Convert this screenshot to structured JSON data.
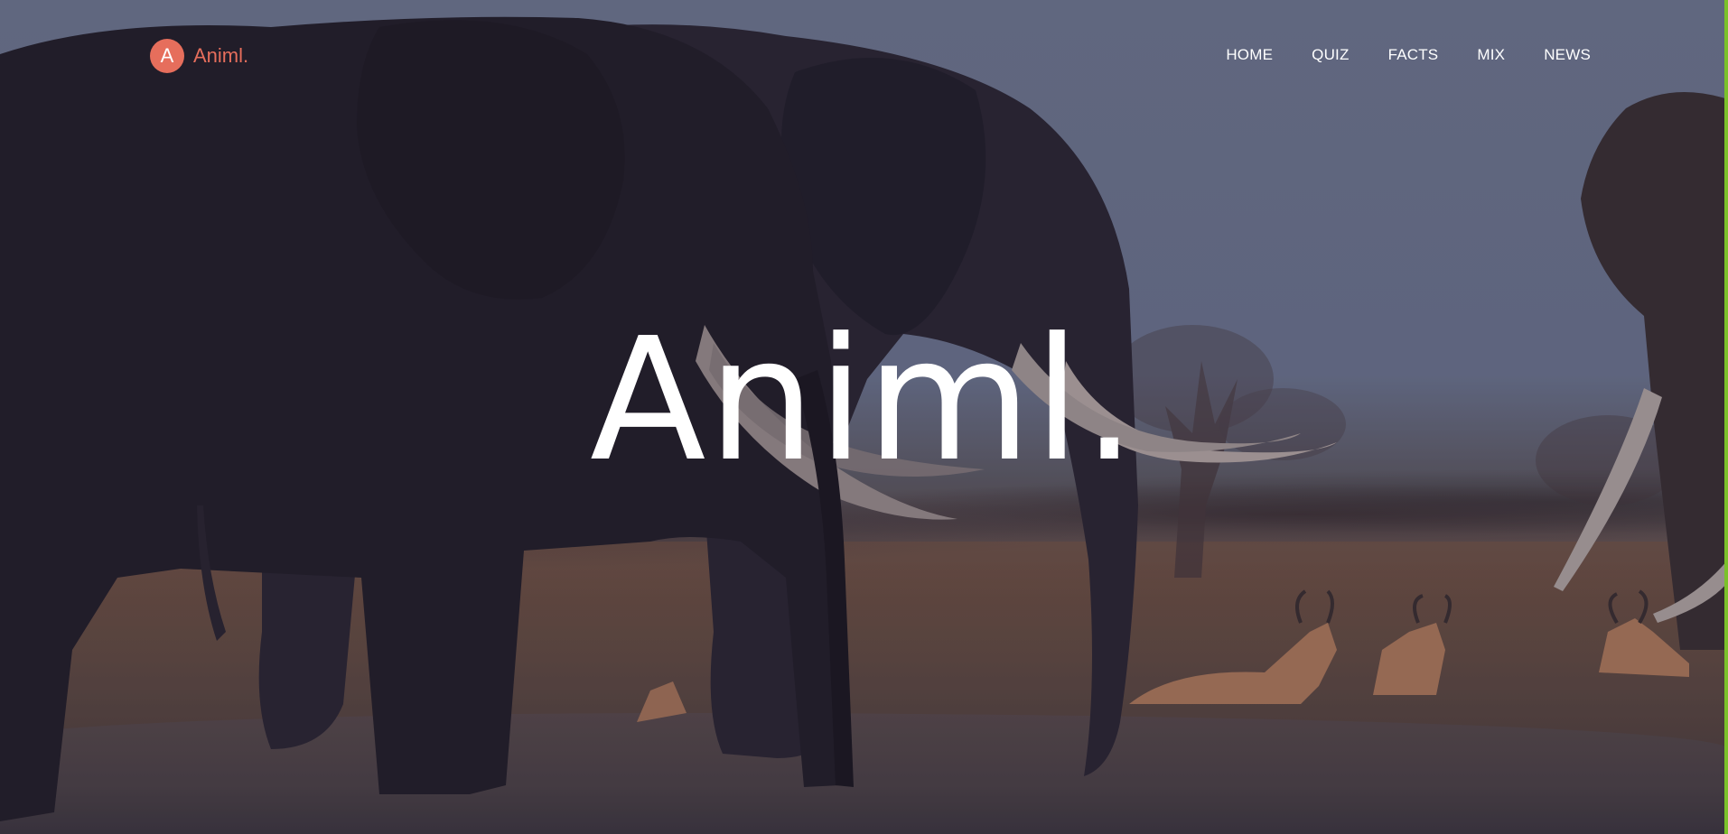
{
  "brand": {
    "badge_letter": "A",
    "name": "Animl.",
    "accent_color": "#e66e5c"
  },
  "nav": {
    "items": [
      {
        "label": "HOME"
      },
      {
        "label": "QUIZ"
      },
      {
        "label": "FACTS"
      },
      {
        "label": "MIX"
      },
      {
        "label": "NEWS"
      }
    ]
  },
  "hero": {
    "title": "Animl.",
    "background": "elephants-savanna-photo"
  },
  "colors": {
    "scrollbar_accent": "#7bc12a",
    "text": "#ffffff"
  }
}
